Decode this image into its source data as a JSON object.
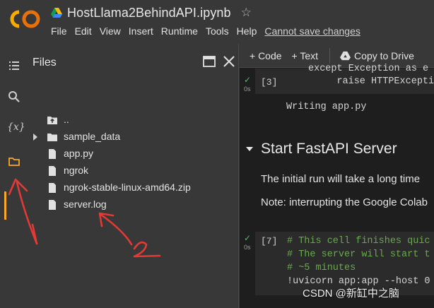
{
  "app": {
    "notebook_name": "HostLlama2BehindAPI.ipynb",
    "logo_text": "CO",
    "colors": {
      "logo_orange": "#f9ab00",
      "logo_dark_orange": "#e8710a",
      "accent": "#f9a825",
      "annotation_red": "#e53935",
      "comment_green": "#6aa84f"
    }
  },
  "menu": {
    "items": [
      "File",
      "Edit",
      "View",
      "Insert",
      "Runtime",
      "Tools",
      "Help"
    ],
    "save_notice": "Cannot save changes"
  },
  "rail": {
    "icons": [
      "toc-icon",
      "search-icon",
      "variables-icon",
      "folder-icon"
    ],
    "variables_label": "{x}"
  },
  "files_panel": {
    "title": "Files",
    "toolbar_icons": [
      "upload-file-icon",
      "refresh-icon",
      "mount-drive-icon",
      "hide-icon"
    ],
    "entries": [
      {
        "name": "..",
        "type": "parent"
      },
      {
        "name": "sample_data",
        "type": "folder"
      },
      {
        "name": "app.py",
        "type": "file"
      },
      {
        "name": "ngrok",
        "type": "file"
      },
      {
        "name": "ngrok-stable-linux-amd64.zip",
        "type": "file"
      },
      {
        "name": "server.log",
        "type": "file"
      }
    ]
  },
  "notebook": {
    "toolbar": {
      "code": "+ Code",
      "text": "+ Text",
      "copy_to_drive": "Copy to Drive"
    },
    "cell1": {
      "exec_count": "[3]",
      "status_time": "0s",
      "lines": [
        "except Exception as e",
        "    raise HTTPExcepti"
      ],
      "output": "Writing app.py"
    },
    "section": {
      "heading": "Start FastAPI Server",
      "text1": "The initial run will take a long time",
      "text2": "Note: interrupting the Google Colab"
    },
    "cell2": {
      "exec_count": "[7]",
      "status_time": "0s",
      "lines": [
        "# This cell finishes quic",
        "# The server will start t",
        "# ~5 minutes",
        "!uvicorn app:app --host 0"
      ]
    }
  },
  "annotations": {
    "label_1": "1",
    "label_2": "2"
  },
  "watermark": "CSDN @新缸中之脑"
}
